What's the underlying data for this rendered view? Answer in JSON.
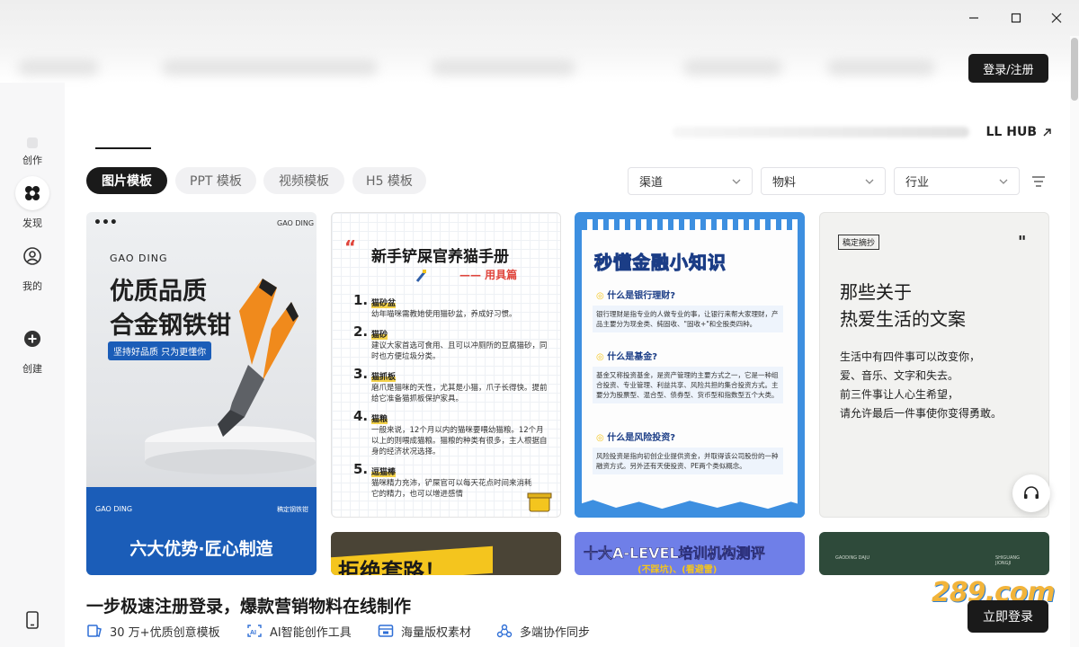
{
  "window": {
    "minimize_icon": "minimize-icon",
    "maximize_icon": "maximize-icon",
    "close_icon": "close-icon"
  },
  "header": {
    "login_label": "登录/注册",
    "hub_link": "LL HUB",
    "hub_icon": "arrow-up-right-icon"
  },
  "sidebar": {
    "items": [
      {
        "label": "创作",
        "icon": "create-icon"
      },
      {
        "label": "发现",
        "icon": "discover-icon"
      },
      {
        "label": "我的",
        "icon": "user-icon"
      },
      {
        "label": "创建",
        "icon": "plus-circle-icon"
      }
    ],
    "bottom_icon": "phone-icon"
  },
  "tabs": [
    "图片模板",
    "PPT 模板",
    "视频模板",
    "H5 模板"
  ],
  "filters": [
    {
      "label": "渠道",
      "icon": "chevron-down-icon"
    },
    {
      "label": "物料",
      "icon": "chevron-down-icon"
    },
    {
      "label": "行业",
      "icon": "chevron-down-icon"
    }
  ],
  "filter_menu_icon": "filter-icon",
  "cards": {
    "pliers": {
      "dots": "•••",
      "brand_top": "GAO DING",
      "brand": "GAO DING",
      "title_line1": "优质品质",
      "title_line2": "合金钢铁钳",
      "badge": "坚持好品质 只为更懂你",
      "footer_brand": "GAO DING",
      "footer_right": "稿定钢铁钳",
      "footer_title": "六大优势·匠心制造"
    },
    "cat": {
      "title": "新手铲屎官养猫手册",
      "subtitle": "—— 用具篇",
      "items": [
        {
          "num": "1.",
          "name": "猫砂盆",
          "text": "幼年喵咪需教她使用猫砂盆，养成好习惯。"
        },
        {
          "num": "2.",
          "name": "猫砂",
          "text": "建议大家首选可食用、且可以冲厕所的豆腐猫砂，同时也方便垃圾分类。"
        },
        {
          "num": "3.",
          "name": "猫抓板",
          "text": "磨爪是猫咪的天性，尤其是小猫，爪子长得快。提前给它准备猫抓板保护家具。"
        },
        {
          "num": "4.",
          "name": "猫粮",
          "text": "一般来说，12个月以内的猫咪要喂幼猫粮。12个月以上的则喂成猫粮。猫粮的种类有很多，主人根据自身的经济状况选择。"
        },
        {
          "num": "5.",
          "name": "逗猫棒",
          "text": "猫咪精力充沛，铲屎官可以每天花点时间来消耗它的精力，也可以增进感情"
        }
      ]
    },
    "finance": {
      "title": "秒懂金融小知识",
      "q1": "什么是银行理财?",
      "a1": "银行理财是指专业的人做专业的事，让银行来帮大家理财，产品主要分为现金类、純固收、\"固收+\"和全股类四种。",
      "q2": "什么是基金?",
      "a2": "基金又称投资基金，是资产管理的主要方式之一，它是一种组合投资、专业管理、利益共享、风险共担的集合投资方式。主要分为股票型、混合型、债券型、货币型和指数型五个大类。",
      "q3": "什么是风险投资?",
      "a3": "风险投资是指向初创企业提供资金，并取得该公司股份的一种融资方式。另外还有天使投资、PE两个类似概念。"
    },
    "quote": {
      "tag": "稿定摘抄",
      "quote_mark": "\"",
      "title_line1": "那些关于",
      "title_line2": "热爱生活的文案",
      "lines": [
        "生活中有四件事可以改变你，",
        "爱、音乐、文字和失去。",
        "前三件事让人心生希望，",
        "请允许最后一件事使你变得勇敢。"
      ]
    },
    "row2": {
      "card1_title": "拒绝套路！",
      "card2_title": "十大A-LEVEL培训机构测评",
      "card2_sub": "(不踩坑)、(看避雷)",
      "card3_left": "GAODING DAJU",
      "card3_right": "SHIGUANG JIONGJI"
    }
  },
  "promo": {
    "title": "一步极速注册登录，爆款营销物料在线制作",
    "features": [
      {
        "icon": "template-icon",
        "label": "30 万+优质创意模板"
      },
      {
        "icon": "ai-icon",
        "label": "AI智能创作工具"
      },
      {
        "icon": "image-library-icon",
        "label": "海量版权素材"
      },
      {
        "icon": "collaboration-icon",
        "label": "多端协作同步"
      }
    ],
    "button": "立即登录"
  },
  "support_icon": "headset-icon",
  "watermark": "289.com",
  "colors": {
    "primary": "#1a1a1a",
    "pliers_orange": "#f08a1c",
    "pliers_blue": "#1b5db8",
    "finance_blue": "#3d8fe0",
    "finance_yellow": "#f4c51e",
    "row2_purple": "#6f7fe8",
    "row2_green": "#2e4a3a"
  }
}
